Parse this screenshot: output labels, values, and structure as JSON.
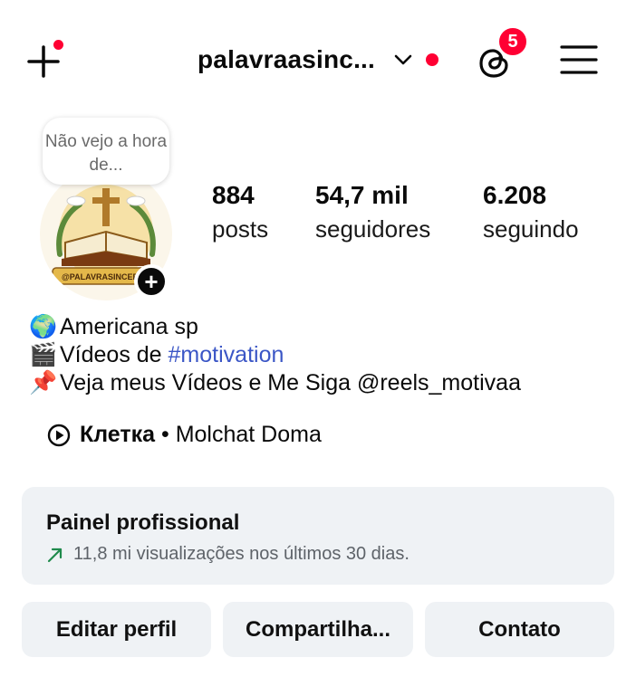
{
  "header": {
    "username": "palavraasinc...",
    "threads_badge": "5"
  },
  "profile": {
    "note": "Não vejo a hora de...",
    "stats": [
      {
        "value": "884",
        "label": "posts"
      },
      {
        "value": "54,7 mil",
        "label": "seguidores"
      },
      {
        "value": "6.208",
        "label": "seguindo"
      }
    ]
  },
  "bio": {
    "line1": {
      "emoji": "🌍",
      "text": "Americana sp"
    },
    "line2": {
      "emoji": "🎬",
      "text": "Vídeos de ",
      "hashtag": "#motivation"
    },
    "line3": {
      "emoji": "📌",
      "text": "Veja meus Vídeos e Me Siga @reels_motivaa"
    },
    "music": {
      "song": "Клетка",
      "separator": " • ",
      "artist": "Molchat Doma"
    }
  },
  "panel": {
    "title": "Painel profissional",
    "subtitle": "11,8 mi visualizações nos últimos 30 dias."
  },
  "buttons": {
    "edit": "Editar perfil",
    "share": "Compartilha...",
    "contact": "Contato"
  },
  "colors": {
    "accent_red": "#ff0033",
    "hashtag_blue": "#3b56c6",
    "panel_bg": "#eff2f5",
    "trend_green": "#1f8a4c"
  }
}
